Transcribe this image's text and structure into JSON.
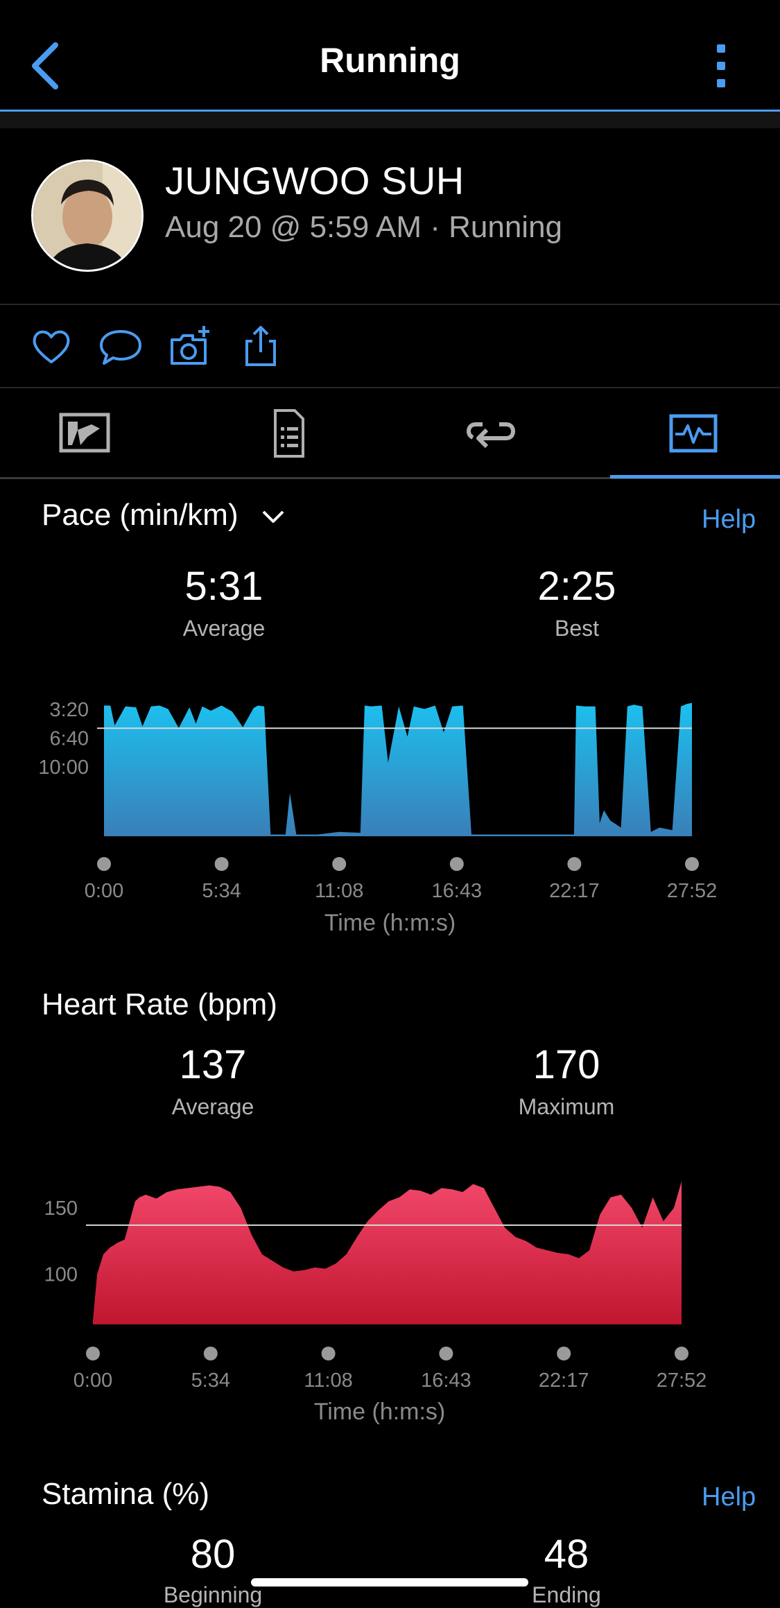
{
  "header": {
    "title": "Running"
  },
  "profile": {
    "name": "JUNGWOO SUH",
    "meta": "Aug 20 @ 5:59 AM · Running"
  },
  "actions": [
    "heart-icon",
    "comment-icon",
    "camera-add-icon",
    "share-icon"
  ],
  "tabs": [
    "map-icon",
    "details-icon",
    "laps-icon",
    "charts-icon"
  ],
  "active_tab": "charts",
  "colors": {
    "accent": "#4a9cf0",
    "pace": "#1fb8ec",
    "heart": "#e8294e"
  },
  "pace": {
    "title": "Pace (min/km)",
    "help": "Help",
    "average_value": "5:31",
    "average_label": "Average",
    "best_value": "2:25",
    "best_label": "Best",
    "x_axis_title": "Time (h:m:s)"
  },
  "heart": {
    "title": "Heart Rate (bpm)",
    "average_value": "137",
    "average_label": "Average",
    "max_value": "170",
    "max_label": "Maximum",
    "x_axis_title": "Time (h:m:s)"
  },
  "stamina": {
    "title": "Stamina (%)",
    "help": "Help",
    "beginning_value": "80",
    "beginning_label": "Beginning",
    "ending_value": "48",
    "ending_label": "Ending"
  },
  "chart_data": [
    {
      "type": "area",
      "ylabel": "Pace (min/km)",
      "xlabel": "Time (h:m:s)",
      "x_ticks": [
        "0:00",
        "5:34",
        "11:08",
        "16:43",
        "22:17",
        "27:52"
      ],
      "y_ticks": [
        "3:20",
        "6:40",
        "10:00"
      ],
      "y_tick_values": [
        3.333,
        6.667,
        10.0
      ],
      "y_range_min_per_km": [
        1.5,
        18.0
      ],
      "y_inverted": true,
      "average_line": 5.52,
      "x": [
        0,
        0.3,
        0.5,
        1,
        1.5,
        1.8,
        2.2,
        2.6,
        3,
        3.5,
        4,
        4.3,
        4.6,
        5,
        5.5,
        6,
        6.5,
        7,
        7.2,
        7.5,
        7.8,
        8.5,
        8.7,
        9,
        10,
        11,
        12,
        12.2,
        12.5,
        13,
        13.3,
        13.8,
        14.2,
        14.5,
        15,
        15.5,
        15.9,
        16.3,
        16.8,
        17.2,
        18,
        20,
        22,
        22.1,
        22.5,
        23,
        23.2,
        23.4,
        23.7,
        24.2,
        24.5,
        24.8,
        25.2,
        25.6,
        26,
        26.6,
        27,
        27.3,
        27.52
      ],
      "y": [
        2.9,
        2.9,
        5.2,
        3.0,
        3.1,
        5.3,
        3.0,
        2.9,
        3.3,
        5.5,
        3.1,
        5.0,
        3.0,
        3.5,
        2.9,
        3.6,
        5.4,
        3.2,
        2.9,
        3.0,
        17.8,
        17.8,
        13.0,
        17.8,
        17.8,
        17.5,
        17.6,
        2.9,
        3.0,
        2.9,
        9.5,
        3.0,
        6.5,
        3.0,
        3.3,
        2.9,
        6.0,
        3.0,
        2.9,
        17.8,
        17.8,
        17.8,
        17.8,
        2.9,
        3.0,
        3.0,
        16.5,
        15.0,
        16.2,
        17.0,
        3.0,
        2.8,
        3.0,
        17.5,
        17.0,
        17.3,
        3.0,
        2.7,
        2.6
      ]
    },
    {
      "type": "area",
      "ylabel": "Heart Rate (bpm)",
      "xlabel": "Time (h:m:s)",
      "x_ticks": [
        "0:00",
        "5:34",
        "11:08",
        "16:43",
        "22:17",
        "27:52"
      ],
      "y_ticks": [
        "150",
        "100"
      ],
      "y_tick_values": [
        150,
        100
      ],
      "y_range": [
        62,
        172
      ],
      "average_line": 137,
      "x": [
        0,
        0.2,
        0.5,
        0.8,
        1.2,
        1.5,
        2,
        2.2,
        2.5,
        3,
        3.5,
        4,
        4.5,
        5,
        5.5,
        6,
        6.5,
        7,
        7.5,
        8,
        8.5,
        9,
        9.5,
        10,
        10.5,
        11,
        11.5,
        12,
        12.5,
        13,
        13.5,
        14,
        14.5,
        15,
        15.5,
        16,
        16.5,
        17,
        17.5,
        18,
        18.5,
        19,
        19.5,
        20,
        20.5,
        21,
        21.5,
        22,
        22.5,
        23,
        23.5,
        24,
        24.5,
        25,
        25.5,
        26,
        26.5,
        27,
        27.5,
        27.86
      ],
      "y": [
        65,
        100,
        115,
        120,
        124,
        126,
        155,
        158,
        160,
        157,
        162,
        164,
        165,
        166,
        167,
        166,
        162,
        150,
        130,
        115,
        110,
        105,
        102,
        103,
        105,
        104,
        108,
        115,
        128,
        140,
        148,
        155,
        158,
        164,
        163,
        160,
        165,
        164,
        162,
        168,
        165,
        150,
        135,
        128,
        125,
        120,
        118,
        116,
        115,
        112,
        118,
        145,
        158,
        160,
        150,
        135,
        158,
        140,
        150,
        170
      ]
    },
    {
      "type": "area",
      "ylabel": "Stamina (%)",
      "values": {
        "Beginning": 80,
        "Ending": 48
      }
    }
  ]
}
